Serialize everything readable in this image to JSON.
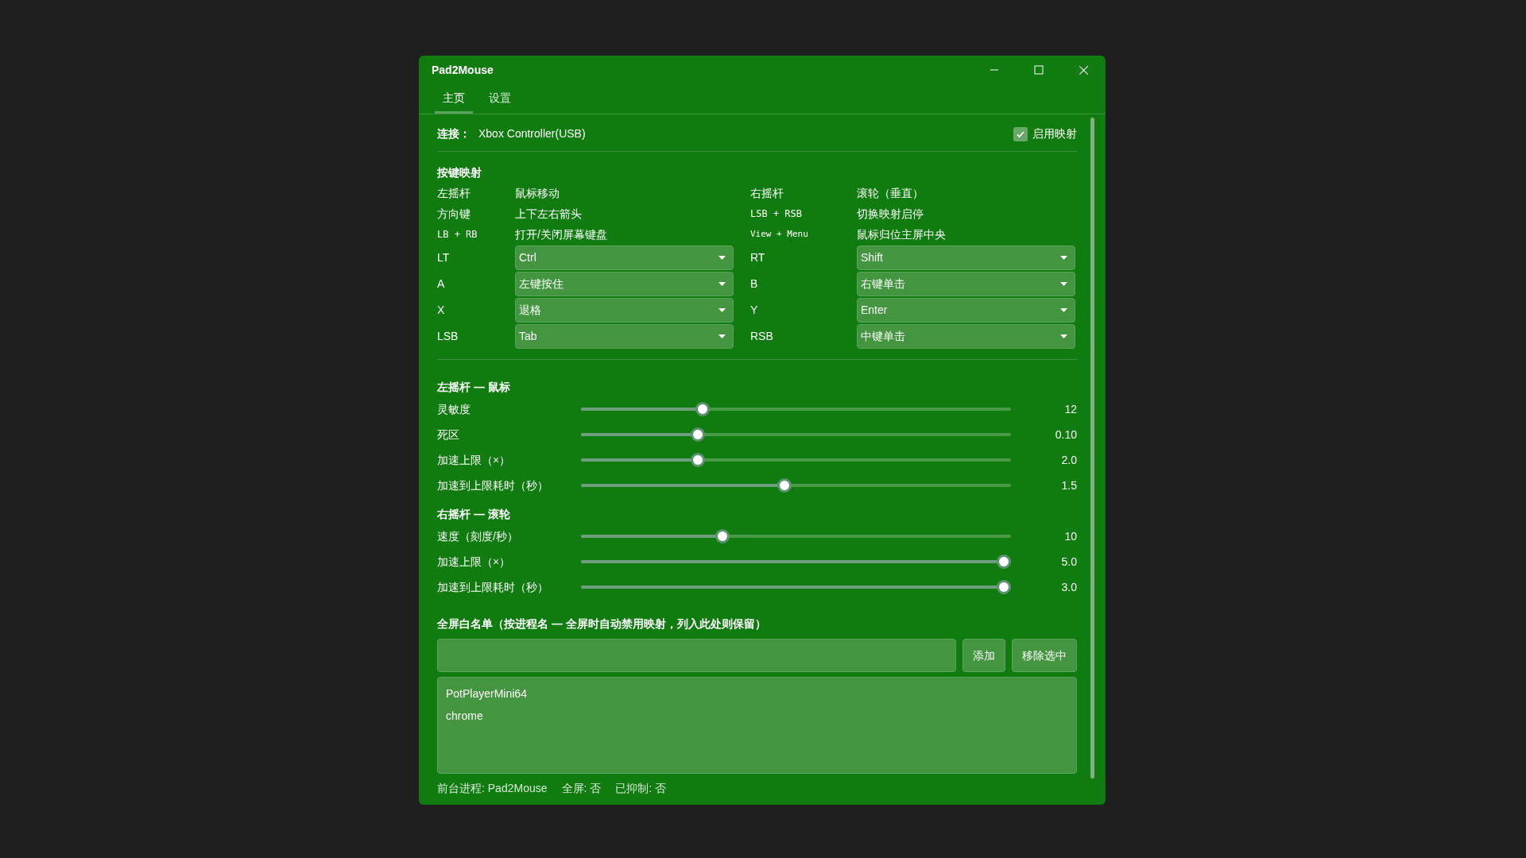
{
  "window": {
    "title": "Pad2Mouse"
  },
  "tabs": [
    {
      "label": "主页",
      "selected": true
    },
    {
      "label": "设置",
      "selected": false
    }
  ],
  "connection": {
    "label": "连接：",
    "value": "Xbox Controller(USB)"
  },
  "enable_mapping": {
    "label": "启用映射",
    "checked": true
  },
  "button_mapping": {
    "heading": "按键映射",
    "items": [
      {
        "kind": "text",
        "key": "左摇杆",
        "mono": false,
        "value": "鼠标移动"
      },
      {
        "kind": "text",
        "key": "右摇杆",
        "mono": false,
        "value": "滚轮（垂直）"
      },
      {
        "kind": "text",
        "key": "方向键",
        "mono": false,
        "value": "上下左右箭头"
      },
      {
        "kind": "text",
        "key": "LSB + RSB",
        "mono": true,
        "value": "切换映射启停"
      },
      {
        "kind": "text",
        "key": "LB + RB",
        "mono": true,
        "value": "打开/关闭屏幕键盘"
      },
      {
        "kind": "text",
        "key": "View + Menu",
        "mono": true,
        "small": true,
        "value": "鼠标归位主屏中央"
      },
      {
        "kind": "select",
        "key": "LT",
        "mono": false,
        "value": "Ctrl"
      },
      {
        "kind": "select",
        "key": "RT",
        "mono": false,
        "value": "Shift"
      },
      {
        "kind": "select",
        "key": "A",
        "mono": false,
        "value": "左键按住"
      },
      {
        "kind": "select",
        "key": "B",
        "mono": false,
        "value": "右键单击"
      },
      {
        "kind": "select",
        "key": "X",
        "mono": false,
        "value": "退格"
      },
      {
        "kind": "select",
        "key": "Y",
        "mono": false,
        "value": "Enter"
      },
      {
        "kind": "select",
        "key": "LSB",
        "mono": false,
        "value": "Tab"
      },
      {
        "kind": "select",
        "key": "RSB",
        "mono": false,
        "value": "中键单击"
      }
    ]
  },
  "slider_groups": [
    {
      "heading": "左摇杆 — 鼠标",
      "sliders": [
        {
          "label": "灵敏度",
          "level": 0.276,
          "reading": "12"
        },
        {
          "label": "死区",
          "level": 0.263,
          "reading": "0.10"
        },
        {
          "label": "加速上限（×）",
          "level": 0.263,
          "reading": "2.0"
        },
        {
          "label": "加速到上限耗时（秒）",
          "level": 0.472,
          "reading": "1.5"
        }
      ]
    },
    {
      "heading": "右摇杆 — 滚轮",
      "sliders": [
        {
          "label": "速度（刻度/秒）",
          "level": 0.323,
          "reading": "10"
        },
        {
          "label": "加速上限（×）",
          "level": 1,
          "reading": "5.0"
        },
        {
          "label": "加速到上限耗时（秒）",
          "level": 1,
          "reading": "3.0"
        }
      ]
    }
  ],
  "whitelist": {
    "heading": "全屏白名单（按进程名 — 全屏时自动禁用映射，列入此处则保留）",
    "buttons": [
      "添加",
      "移除选中"
    ],
    "items": [
      "PotPlayerMini64",
      "chrome"
    ]
  },
  "status_bar": [
    "前台进程: Pad2Mouse",
    "全屏: 否",
    "已抑制: 否"
  ]
}
